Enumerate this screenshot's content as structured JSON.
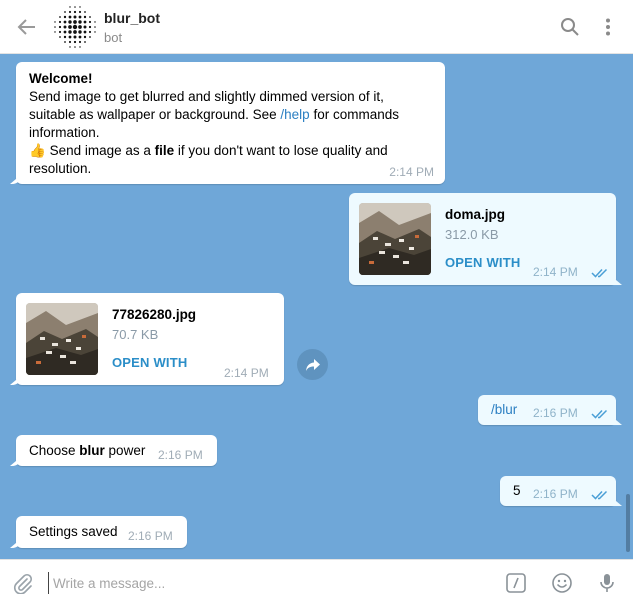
{
  "header": {
    "bot_name": "blur_bot",
    "bot_status": "bot"
  },
  "messages": {
    "welcome": {
      "title": "Welcome!",
      "line1": "Send image to get blurred and slightly dimmed version of it,",
      "line2a": "suitable as wallpaper or background. See ",
      "line2_link": "/help",
      "line2b": " for commands",
      "line3": "information.",
      "line4_emoji": "👍",
      "line4a": " Send image as a ",
      "line4_bold": "file",
      "line4b": " if you don't want to lose quality and",
      "line5": "resolution.",
      "time": "2:14 PM"
    },
    "file_out": {
      "name": "doma.jpg",
      "size": "312.0 KB",
      "action": "OPEN WITH",
      "time": "2:14 PM"
    },
    "file_in": {
      "name": "77826280.jpg",
      "size": "70.7 KB",
      "action": "OPEN WITH",
      "time": "2:14 PM"
    },
    "blur_cmd": {
      "text": "/blur",
      "time": "2:16 PM"
    },
    "choose": {
      "text_a": "Choose ",
      "text_bold": "blur",
      "text_b": " power",
      "time": "2:16 PM"
    },
    "five": {
      "text": "5",
      "time": "2:16 PM"
    },
    "saved": {
      "text": "Settings saved",
      "time": "2:16 PM"
    }
  },
  "input": {
    "placeholder": "Write a message..."
  },
  "icons": {
    "back": "arrow-left-icon",
    "search": "search-icon",
    "menu": "more-vertical-icon",
    "share": "forward-icon",
    "attach": "paperclip-icon",
    "command": "slash-command-icon",
    "emoji": "smiley-icon",
    "mic": "microphone-icon",
    "ticks": "double-check-icon"
  },
  "colors": {
    "chat_bg": "#6fa7d8",
    "incoming": "#ffffff",
    "outgoing": "#eefaff",
    "link": "#2b7fc2",
    "accent": "#2b8ec8"
  }
}
